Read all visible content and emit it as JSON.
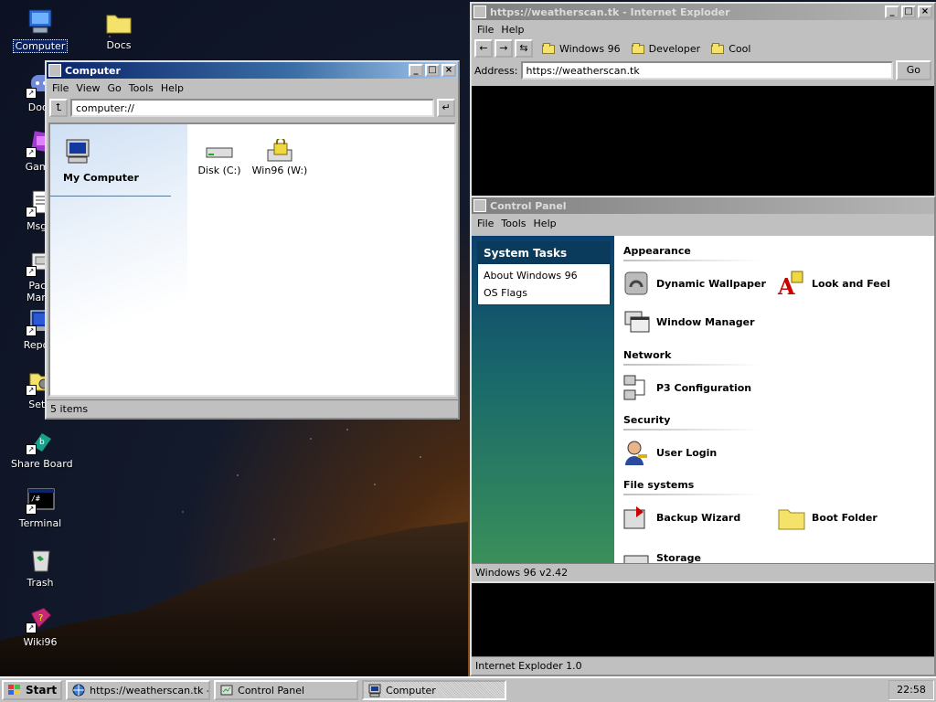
{
  "desktop": {
    "icons": [
      {
        "label": "Computer",
        "icon": "computer-icon"
      },
      {
        "label": "Docs",
        "icon": "folder-icon"
      },
      {
        "label": "Door",
        "icon": "discord-icon"
      },
      {
        "label": "Game",
        "icon": "game-icon"
      },
      {
        "label": "MsgR",
        "icon": "messenger-icon"
      },
      {
        "label": "Pack",
        "label2": "Mana",
        "icon": "package-icon"
      },
      {
        "label": "Report",
        "icon": "report-icon"
      },
      {
        "label": "Setti",
        "icon": "settings-icon"
      },
      {
        "label": "Share Board",
        "icon": "share-board-icon"
      },
      {
        "label": "Terminal",
        "icon": "terminal-icon"
      },
      {
        "label": "Trash",
        "icon": "trash-icon"
      },
      {
        "label": "Wiki96",
        "icon": "wiki-icon"
      }
    ]
  },
  "ie": {
    "title": "https://weatherscan.tk - Internet Exploder",
    "menu": [
      "File",
      "Help"
    ],
    "favorites": [
      "Windows 96",
      "Developer",
      "Cool"
    ],
    "address_label": "Address:",
    "address_value": "https://weatherscan.tk",
    "go_label": "Go",
    "status": "Internet Exploder 1.0"
  },
  "computer": {
    "title": "Computer",
    "menu": [
      "File",
      "View",
      "Go",
      "Tools",
      "Help"
    ],
    "path": "computer://",
    "sidebar_title": "My Computer",
    "items": [
      {
        "label": "Disk (C:)",
        "icon": "disk-drive-icon"
      },
      {
        "label": "Win96 (W:)",
        "icon": "locked-drive-icon"
      }
    ],
    "status": "5 items"
  },
  "control_panel": {
    "title": "Control Panel",
    "menu": [
      "File",
      "Tools",
      "Help"
    ],
    "tasks_title": "System Tasks",
    "tasks": [
      "About Windows 96",
      "OS Flags"
    ],
    "sections": {
      "appearance": "Appearance",
      "network": "Network",
      "security": "Security",
      "filesystems": "File systems"
    },
    "items": {
      "dynamic_wallpaper": "Dynamic Wallpaper",
      "look_and_feel": "Look and Feel",
      "window_manager": "Window Manager",
      "p3_configuration": "P3 Configuration",
      "user_login": "User Login",
      "backup_wizard": "Backup Wizard",
      "boot_folder": "Boot Folder",
      "storage": "Storage"
    },
    "status": "Windows 96 v2.42"
  },
  "taskbar": {
    "start_label": "Start",
    "tasks": [
      "https://weatherscan.tk - ...",
      "Control Panel",
      "Computer"
    ],
    "clock": "22:58"
  }
}
